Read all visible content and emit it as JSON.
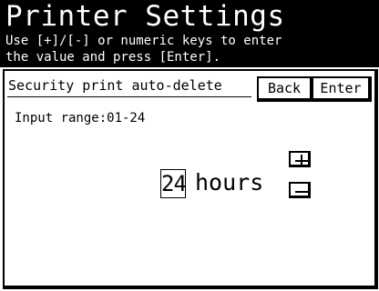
{
  "header": {
    "title": "Printer Settings",
    "instruction_line1": "Use [+]/[-] or numeric keys to enter",
    "instruction_line2": "the value and press [Enter]."
  },
  "panel": {
    "field_label": "Security print auto-delete",
    "back_label": "Back",
    "enter_label": "Enter",
    "range_text": "Input range:01-24",
    "value": "24",
    "unit": "hours",
    "increment_icon": "plus-icon",
    "decrement_icon": "minus-icon"
  },
  "colors": {
    "header_background": "#000000",
    "header_text": "#ffffff",
    "panel_background": "#ffffff",
    "text": "#000000"
  }
}
